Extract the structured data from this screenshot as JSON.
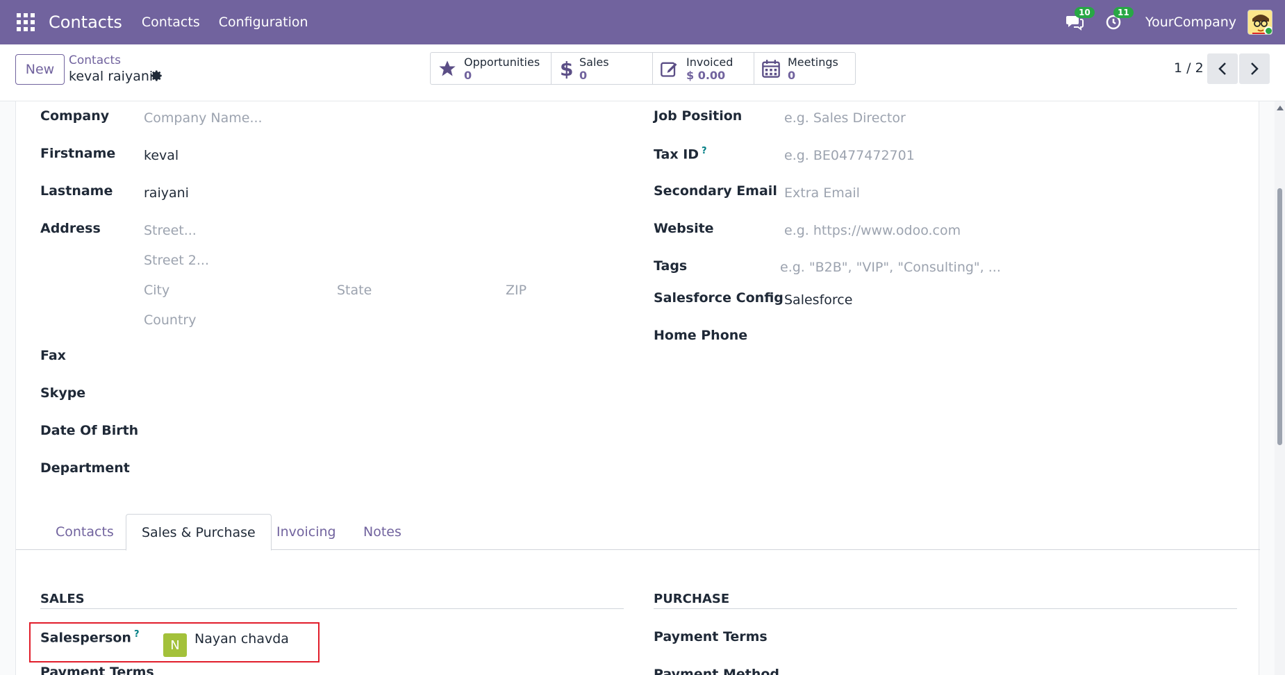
{
  "navbar": {
    "brand": "Contacts",
    "menus": [
      "Contacts",
      "Configuration"
    ],
    "messages_badge": "10",
    "activities_badge": "11",
    "company": "YourCompany"
  },
  "control": {
    "new_label": "New",
    "breadcrumb_parent": "Contacts",
    "breadcrumb_current": "keval raiyani",
    "pager": "1 / 2",
    "stats": [
      {
        "label": "Opportunities",
        "value": "0",
        "icon": "star-icon"
      },
      {
        "label": "Sales",
        "value": "0",
        "icon": "dollar-icon"
      },
      {
        "label": "Invoiced",
        "value": "$ 0.00",
        "icon": "edit-icon"
      },
      {
        "label": "Meetings",
        "value": "0",
        "icon": "calendar-icon"
      }
    ]
  },
  "form": {
    "left": {
      "company_label": "Company",
      "company_placeholder": "Company Name...",
      "firstname_label": "Firstname",
      "firstname_value": "keval",
      "lastname_label": "Lastname",
      "lastname_value": "raiyani",
      "address_label": "Address",
      "street_placeholder": "Street...",
      "street2_placeholder": "Street 2...",
      "city_placeholder": "City",
      "state_placeholder": "State",
      "zip_placeholder": "ZIP",
      "country_placeholder": "Country",
      "fax_label": "Fax",
      "skype_label": "Skype",
      "dob_label": "Date Of Birth",
      "department_label": "Department"
    },
    "right": {
      "job_label": "Job Position",
      "job_placeholder": "e.g. Sales Director",
      "tax_label": "Tax ID",
      "tax_placeholder": "e.g. BE0477472701",
      "secondary_email_label": "Secondary Email",
      "secondary_email_placeholder": "Extra Email",
      "website_label": "Website",
      "website_placeholder": "e.g. https://www.odoo.com",
      "tags_label": "Tags",
      "tags_placeholder": "e.g. \"B2B\", \"VIP\", \"Consulting\", ...",
      "salesforce_label": "Salesforce Config",
      "salesforce_value": "Salesforce",
      "home_phone_label": "Home Phone"
    },
    "qmark": "?"
  },
  "tabs": [
    "Contacts",
    "Sales & Purchase",
    "Invoicing",
    "Notes"
  ],
  "sales": {
    "title": "SALES",
    "salesperson_label": "Salesperson",
    "salesperson_initial": "N",
    "salesperson_value": "Nayan chavda",
    "payment_terms_label": "Payment Terms"
  },
  "purchase": {
    "title": "PURCHASE",
    "payment_terms_label": "Payment Terms",
    "payment_method_label": "Payment Method"
  },
  "colors": {
    "brand": "#71639e",
    "highlight": "#e11d2a",
    "avatar_bg": "#a3c13a"
  }
}
